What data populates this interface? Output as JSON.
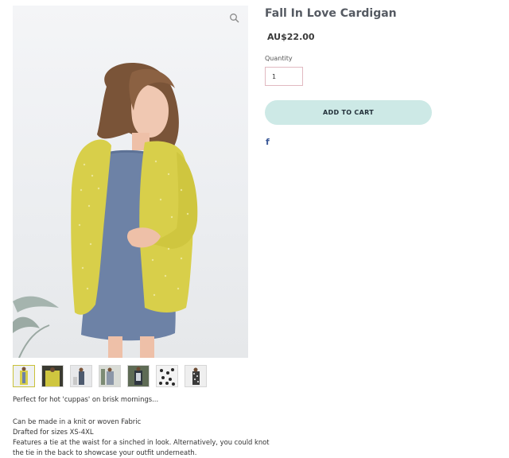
{
  "product": {
    "title": "Fall In Love Cardigan",
    "price": "AU$22.00"
  },
  "quantity": {
    "label": "Quantity",
    "value": "1"
  },
  "actions": {
    "add_to_cart": "ADD TO CART",
    "share_icon": "facebook-icon",
    "share_glyph": "f"
  },
  "gallery": {
    "zoom_icon": "zoom-icon",
    "thumbnail_count": 7,
    "selected_thumbnail": 1
  },
  "description": {
    "intro": "Perfect for hot 'cuppas' on brisk mornings...",
    "line_1": "Can be made in a knit or woven Fabric",
    "line_2": "Drafted for sizes XS-4XL",
    "line_3": "Features a tie at the waist for a sinched in look. Alternatively, you could knot the tie in the back to showcase your outfit underneath."
  },
  "colors": {
    "button_bg": "#cde9e6",
    "cardigan": "#d8cf4a",
    "dress": "#6d82a6",
    "facebook": "#3b5998"
  }
}
